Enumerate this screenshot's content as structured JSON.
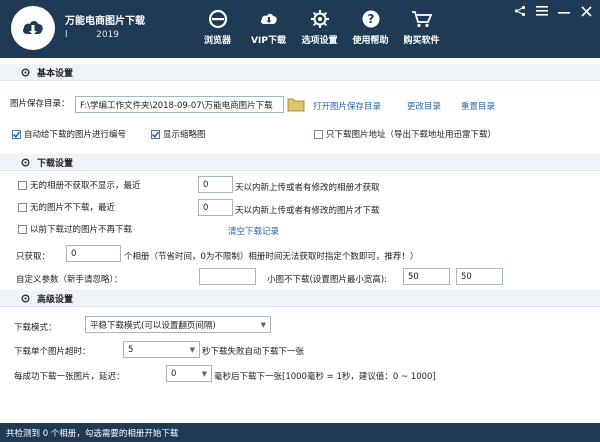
{
  "app": {
    "title": "万能电商图片下载",
    "version_line": "l          2019"
  },
  "nav": [
    {
      "label": "浏览器",
      "icon": "browser-icon"
    },
    {
      "label": "VIP下载",
      "icon": "cloud-download-icon"
    },
    {
      "label": "选项设置",
      "icon": "gear-icon"
    },
    {
      "label": "使用帮助",
      "icon": "help-icon"
    },
    {
      "label": "购买软件",
      "icon": "cart-icon"
    }
  ],
  "window_controls": {
    "share": "share-icon",
    "menu": "menu-icon",
    "minimize": "minimize-icon",
    "close": "close-icon"
  },
  "basic": {
    "title": "基本设置",
    "save_dir_label": "图片保存目录：",
    "save_dir_value": "F:\\学编工作文件夹\\2018-09-07\\万能电商图片下载",
    "open_dir_link": "打开图片保存目录",
    "change_dir_link": "更改目录",
    "reset_dir_link": "重置目录",
    "auto_number_label": "自动给下载的图片进行编号",
    "show_thumb_label": "显示缩略图",
    "only_links_label": "只下载图片地址（导出下载地址用迅雷下载）"
  },
  "download": {
    "title": "下载设置",
    "skip_album_label": "无的相册不获取不显示，最近",
    "album_days": "0",
    "album_hint": "天以内新上传或者有修改的相册才获取",
    "skip_image_label": "无的图片不下载，最近",
    "image_days": "0",
    "image_hint": "天以内新上传或者有修改的图片才下载",
    "skip_downloaded_label": "以前下载过的图片不再下载",
    "clear_records_link": "清空下载记录",
    "only_get_label": "只获取：",
    "only_get_value": "0",
    "only_get_hint": "个相册（节省时间，0为不限制）相册时间无法获取时指定个数即可，推荐！）",
    "custom_param_label": "自定义参数（新手请忽略）：",
    "custom_param_value": "",
    "min_size_label": "小图不下载(设置图片最小宽高):",
    "min_width": "50",
    "min_height": "50"
  },
  "advanced": {
    "title": "高级设置",
    "mode_label": "下载模式：",
    "mode_value": "平稳下载模式(可以设置翻页间隔)",
    "single_timeout_label": "下载单个图片超时：",
    "single_timeout_value": "5",
    "single_timeout_hint": "秒下载失败自动下载下一张",
    "delay_label": "每成功下载一张图片，延迟：",
    "delay_value": "0",
    "delay_hint": "毫秒后下载下一张[1000毫秒 = 1秒，建议值：0 ~ 1000]"
  },
  "status": "共检测到 0 个相册，勾选需要的相册开始下载",
  "colors": {
    "header": "#1f3a55",
    "link": "#2d66b5",
    "section_bg": "#f0f4f8"
  }
}
